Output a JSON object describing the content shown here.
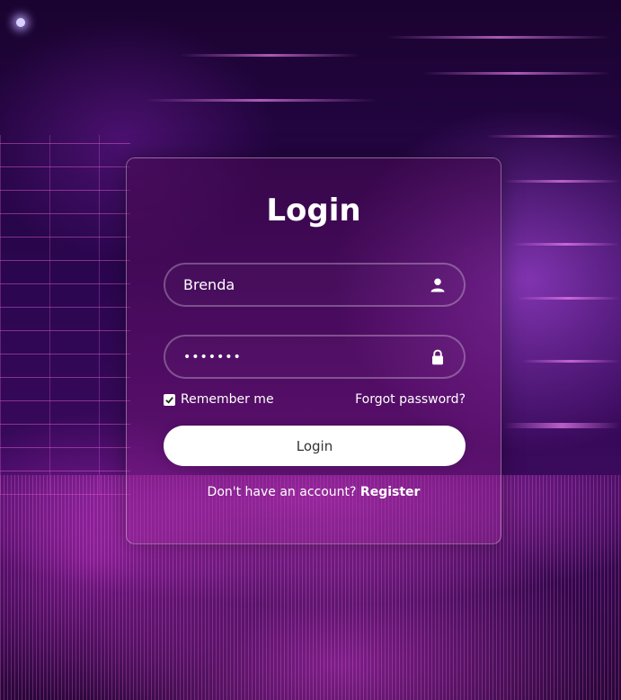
{
  "form": {
    "title": "Login",
    "username": {
      "value": "Brenda",
      "icon": "user-icon"
    },
    "password": {
      "value": "•••••••",
      "icon": "lock-icon"
    },
    "remember_label": "Remember me",
    "remember_checked": true,
    "forgot_label": "Forgot password?",
    "submit_label": "Login",
    "register_prompt": "Don't have an account?",
    "register_label": "Register"
  },
  "colors": {
    "text": "#ffffff",
    "button_bg": "#ffffff",
    "button_text": "#333333",
    "accent": "#d63be0"
  }
}
